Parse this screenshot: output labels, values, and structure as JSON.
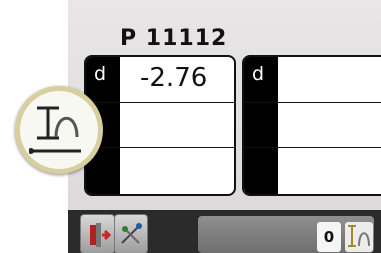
{
  "screen": {
    "title": "P 11112"
  },
  "cards": [
    {
      "label": "d",
      "value": "-2.76"
    },
    {
      "label": "d",
      "value": ""
    }
  ],
  "bottom_bar": {
    "counter_value": "0"
  },
  "icons": {
    "exit_icon": "exit-door-icon",
    "tool_icon": "probe-tool-icon",
    "measure_icon": "measure-icon"
  }
}
